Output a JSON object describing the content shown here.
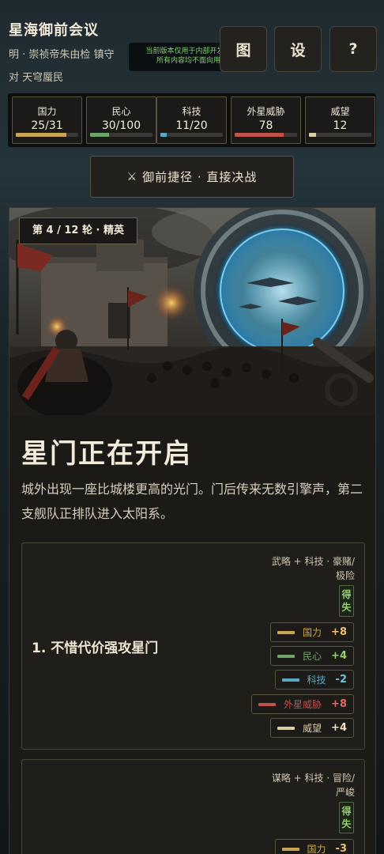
{
  "header": {
    "title": "星海御前会议",
    "subtitle_line1": "明 · 崇祯帝朱由检 镇守",
    "subtitle_line2": "对 天穹蜃民",
    "dev_notice_line1": "当前版本仅用于内部开发测试",
    "dev_notice_line2": "所有内容均不面向用户",
    "buttons": {
      "map": "图",
      "settings": "设",
      "help": "?"
    }
  },
  "stats": [
    {
      "label": "国力",
      "value": "25/31",
      "level": 0.806,
      "color": "#c9a452"
    },
    {
      "label": "民心",
      "value": "30/100",
      "level": 0.3,
      "color": "#6ea36a"
    },
    {
      "label": "科技",
      "value": "11/20",
      "level": 0.1,
      "color": "#58a9c4"
    },
    {
      "label": "外星威胁",
      "value": "78",
      "level": 0.78,
      "color": "#c0524a"
    },
    {
      "label": "威望",
      "value": "12",
      "level": 0.12,
      "color": "#d9cba6"
    }
  ],
  "battle_button": {
    "icon": "crossed-swords-icon",
    "label": "御前捷径 · 直接决战"
  },
  "event": {
    "round_badge": "第 4 / 12 轮 · 精英",
    "title": "星门正在开启",
    "description": "城外出现一座比城楼更高的光门。门后传来无数引擎声，第二支舰队正排队进入太阳系。",
    "options": [
      {
        "tags_line1": "武略 + 科技 · 豪赌/",
        "tags_line2": "极险",
        "risk_label": "得失",
        "label": "1. 不惜代价强攻星门",
        "effects": [
          {
            "name": "国力",
            "delta": "+8",
            "color": "#c9a452",
            "delta_color": "#e8c36a"
          },
          {
            "name": "民心",
            "delta": "+4",
            "color": "#6ea36a",
            "delta_color": "#8fd16d"
          },
          {
            "name": "科技",
            "delta": "-2",
            "color": "#58a9c4",
            "delta_color": "#6cc0dc"
          },
          {
            "name": "外星威胁",
            "delta": "+8",
            "color": "#c0524a",
            "delta_color": "#e46a5f"
          },
          {
            "name": "威望",
            "delta": "+4",
            "color": "#d9cba6",
            "delta_color": "#efe4c4"
          }
        ]
      },
      {
        "tags_line1": "谋略 + 科技 · 冒险/",
        "tags_line2": "严峻",
        "risk_label": "得失",
        "effects": [
          {
            "name": "国力",
            "delta": "-3",
            "color": "#c9a452",
            "delta_color": "#e8c36a"
          }
        ]
      }
    ]
  }
}
